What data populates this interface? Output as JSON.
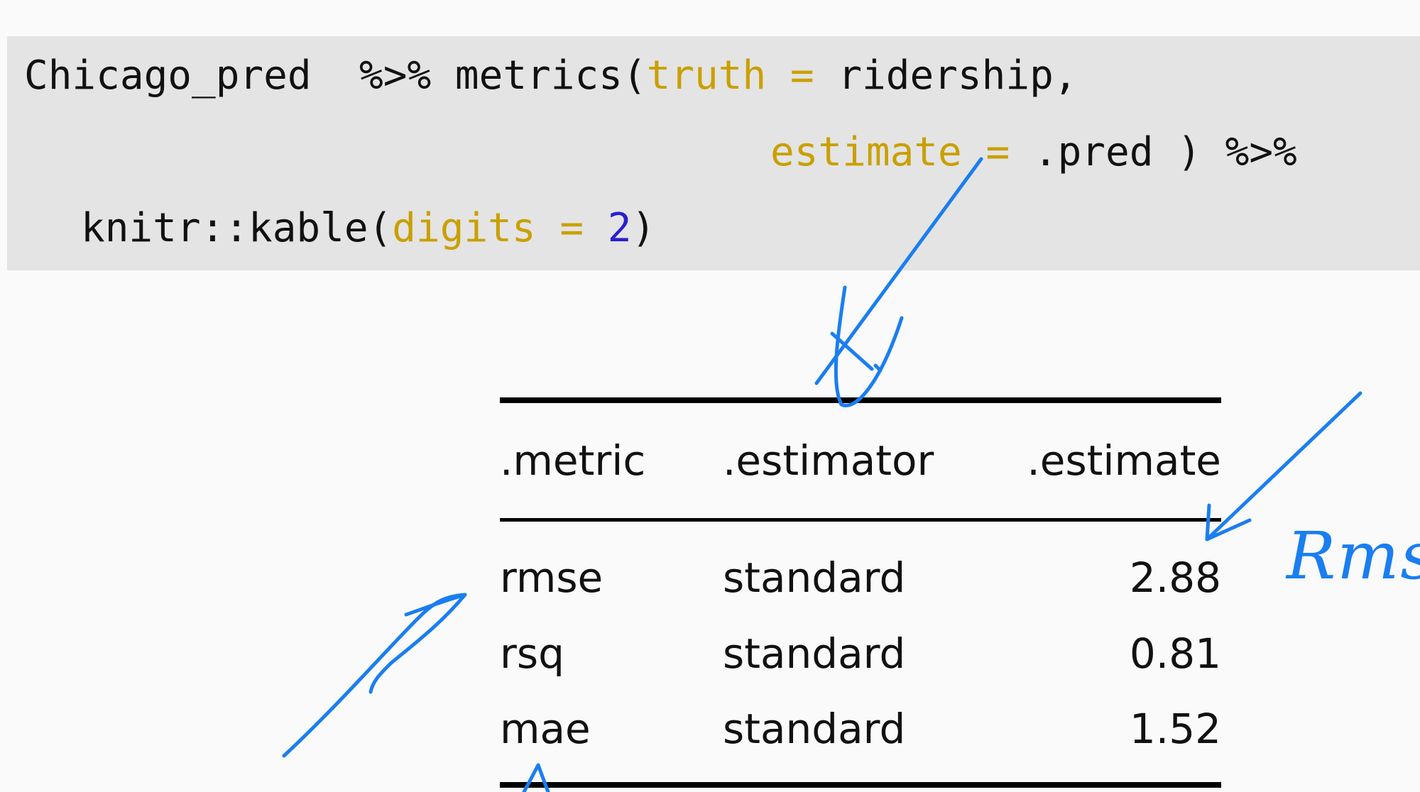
{
  "code": {
    "line1": {
      "object": "Chicago_pred",
      "pipe": "%>%",
      "func": "metrics(",
      "arg1_name": "truth",
      "eq": "=",
      "arg1_value": "ridership,"
    },
    "line2": {
      "arg2_name": "estimate",
      "eq": "=",
      "arg2_value": ".pred )",
      "pipe": "%>%"
    },
    "line3": {
      "func": "knitr::kable(",
      "arg_name": "digits",
      "eq": "=",
      "arg_value": "2",
      "close": ")"
    }
  },
  "table": {
    "headers": [
      ".metric",
      ".estimator",
      ".estimate"
    ],
    "rows": [
      {
        "metric": "rmse",
        "estimator": "standard",
        "estimate": "2.88"
      },
      {
        "metric": "rsq",
        "estimator": "standard",
        "estimate": "0.81"
      },
      {
        "metric": "mae",
        "estimator": "standard",
        "estimate": "1.52"
      }
    ]
  },
  "annotations": {
    "handwritten_note": "Rms",
    "ink_color": "#1a7ef0"
  }
}
